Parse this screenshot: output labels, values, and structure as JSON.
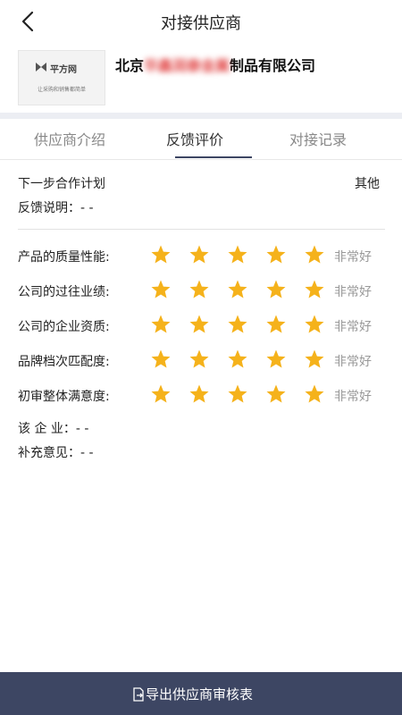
{
  "header": {
    "title": "对接供应商"
  },
  "supplier": {
    "logo_name": "平方网",
    "logo_tagline": "让采购和销售都简单",
    "name_prefix": "北京",
    "name_blurred": "华鑫润泰金属",
    "name_suffix": "制品有限公司"
  },
  "tabs": [
    {
      "label": "供应商介绍"
    },
    {
      "label": "反馈评价"
    },
    {
      "label": "对接记录"
    }
  ],
  "active_tab": 1,
  "feedback": {
    "next_step_label": "下一步合作计划",
    "next_step_value": "其他",
    "explain_label": "反馈说明：- -"
  },
  "ratings": [
    {
      "label": "产品的质量性能:",
      "stars": 5,
      "max": 5,
      "text": "非常好"
    },
    {
      "label": "公司的过往业绩:",
      "stars": 5,
      "max": 5,
      "text": "非常好"
    },
    {
      "label": "公司的企业资质:",
      "stars": 5,
      "max": 5,
      "text": "非常好"
    },
    {
      "label": "品牌档次匹配度:",
      "stars": 5,
      "max": 5,
      "text": "非常好"
    },
    {
      "label": "初审整体满意度:",
      "stars": 5,
      "max": 5,
      "text": "非常好"
    }
  ],
  "extra": {
    "company_line": "该 企 业：- -",
    "supplement_line": "补充意见：- -"
  },
  "bottom_button": {
    "label": "导出供应商审核表"
  },
  "colors": {
    "star": "#f5b21b",
    "accent": "#3d4663",
    "rating_text": "#999999"
  }
}
